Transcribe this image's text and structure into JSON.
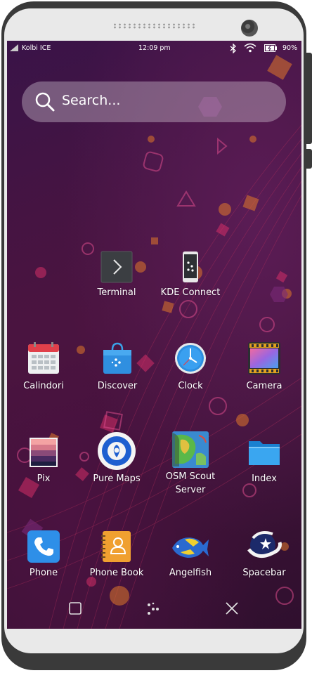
{
  "statusbar": {
    "carrier": "Kolbi ICE",
    "time": "12:09 pm",
    "battery": "90%",
    "icons": [
      "signal-icon",
      "bluetooth-icon",
      "wifi-icon",
      "battery-icon"
    ]
  },
  "search": {
    "placeholder": "Search..."
  },
  "apps": {
    "terminal": "Terminal",
    "kde_connect": "KDE Connect",
    "calindori": "Calindori",
    "discover": "Discover",
    "clock": "Clock",
    "camera": "Camera",
    "pix": "Pix",
    "pure_maps": "Pure Maps",
    "osm_line1": "OSM Scout",
    "osm_line2": "Server",
    "index": "Index",
    "phone": "Phone",
    "phone_book": "Phone Book",
    "angelfish": "Angelfish",
    "spacebar": "Spacebar"
  },
  "navbar": {
    "icons": [
      "overview-icon",
      "kde-connect-nav-icon",
      "close-icon"
    ]
  },
  "colors": {
    "wallpaper": "#3a1348",
    "accent_orange": "#e0782a",
    "accent_pink": "#e0306a"
  }
}
